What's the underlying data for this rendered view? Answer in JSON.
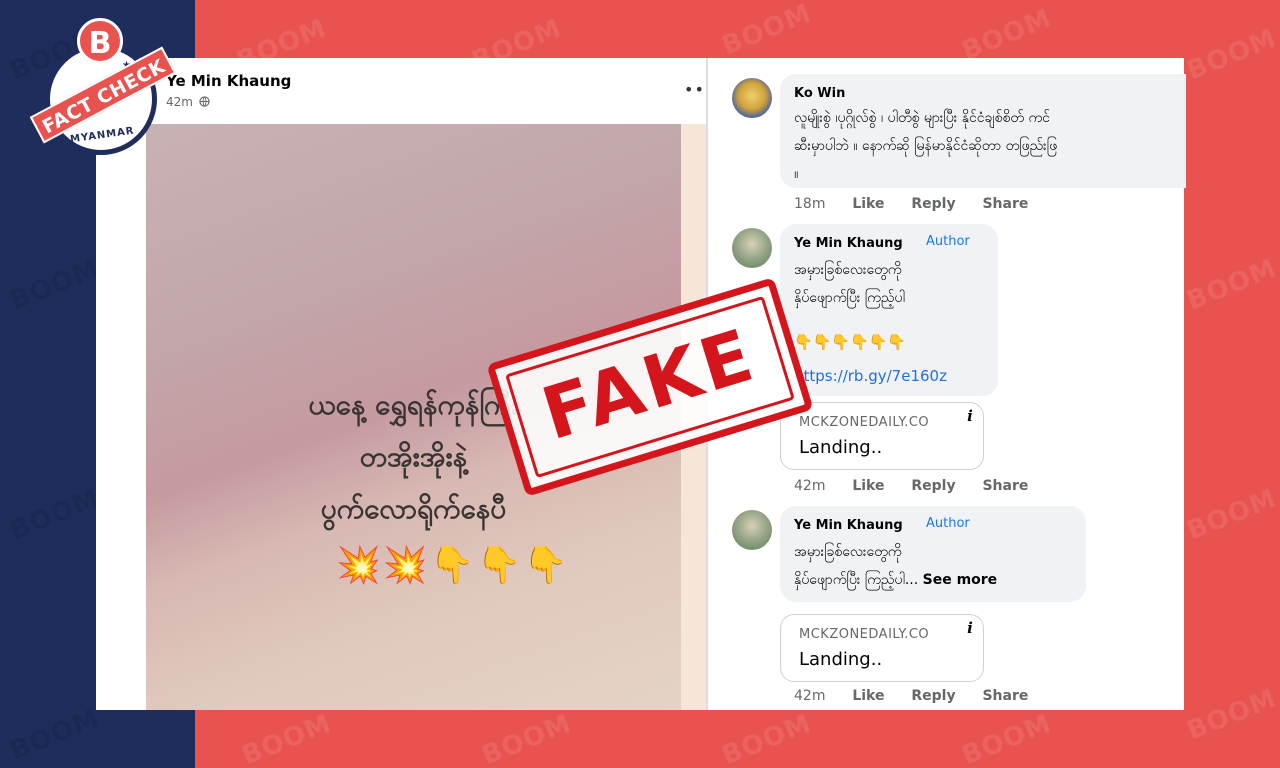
{
  "watermark": {
    "text": "BOOM"
  },
  "badge": {
    "logo_letter": "B",
    "ribbon": "FACT CHECK",
    "country": "MYANMAR"
  },
  "post": {
    "author": "Ye Min Khaung",
    "time": "42m",
    "privacy_icon": "globe-icon",
    "menu": "•••",
    "caption_lines": [
      "ယနေ့ ရွှေရန်ကုန်ကြီး",
      "တအိုးအိုးနဲ့",
      "ပွက်လောရိုက်နေပီ"
    ],
    "emojis": "💥💥👇👇👇"
  },
  "stamp": {
    "text": "FAKE",
    "color": "#d4161c"
  },
  "comments": [
    {
      "author": "Ko Win",
      "lines": [
        "လူမျိုးစွဲ ၊ပုဂ္ဂိုလ်စွဲ ၊ ပါတီစွဲ များပြီး နိုင်ငံချစ်စိတ် ကင်",
        "ဆီးမှာပါဘဲ ။ နောက်ဆို မြန်မာနိုင်ငံဆိုတာ တဖြည်းဖြ",
        "။"
      ],
      "time": "18m",
      "like": "Like",
      "reply": "Reply",
      "share": "Share"
    },
    {
      "author": "Ye Min Khaung",
      "badge": "Author",
      "lines": [
        "အမှားခြစ်လေးတွေကို",
        "နှိပ်ဖျောက်ပြီး ကြည့်ပါ"
      ],
      "emojis": "👇👇👇👇👇👇",
      "link": "https://rb.gy/7e160z",
      "card_domain": "MCKZONEDAILY.CO",
      "card_title": "Landing..",
      "time": "42m",
      "like": "Like",
      "reply": "Reply",
      "share": "Share"
    },
    {
      "author": "Ye Min Khaung",
      "badge": "Author",
      "line1": "အမှားခြစ်လေးတွေကို",
      "line2": "နှိပ်ဖျောက်ပြီး ကြည့်ပါ...",
      "see_more": "See more",
      "card_domain": "MCKZONEDAILY.CO",
      "card_title": "Landing..",
      "time": "42m",
      "like": "Like",
      "reply": "Reply",
      "share": "Share"
    }
  ],
  "colors": {
    "brand_red": "#e8524f",
    "brand_navy": "#1f2d5c",
    "link_blue": "#216fdb"
  }
}
